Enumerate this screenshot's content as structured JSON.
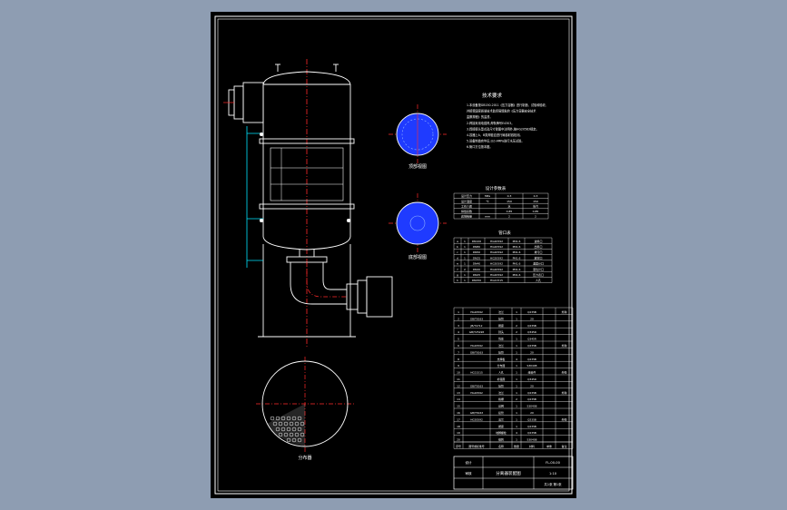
{
  "drawing": {
    "theme": {
      "background": "#8e9db2",
      "paper": "#000000",
      "line": "#ffffff",
      "centerline": "#ff2a2a",
      "nozzle": "#00e5ff",
      "view_fill": "#1f3bff"
    },
    "tech_req_title": "技术要求",
    "tech_req_lines": [
      "1.本设备按GB150-2011《压力容器》进行制造、试验和验收,",
      "并接受国家质量技术监督局颁发的《压力容器安全技术",
      "监察规程》的监督。",
      "2.焊接采用电弧焊,焊条牌号E4303。",
      "3.焊接接头型式及尺寸除图中注明外,按HG20583规定。",
      "4.容器上A、B类焊缝应进行局部射线检测。",
      "5.设备制造完毕后,以0.4MPa进行水压试验。",
      "6.管口方位按本图。"
    ],
    "view_labels": {
      "top_view": "顶部视图",
      "bottom_view": "底部视图",
      "section": "分布器"
    },
    "design_data_title": "设计参数表",
    "design_rows": [
      [
        "设计压力",
        "MPa",
        "0.3",
        "0.3"
      ],
      [
        "设计温度",
        "℃",
        "150",
        "150"
      ],
      [
        "工作介质",
        "",
        "水",
        "蒸汽"
      ],
      [
        "焊缝系数",
        "",
        "0.85",
        "0.85"
      ],
      [
        "腐蚀裕量",
        "mm",
        "2",
        "2"
      ]
    ],
    "nozzle_title": "管口表",
    "nozzle_rows": [
      [
        "a",
        "1",
        "DN100",
        "HG20592",
        "PN1.6",
        "进料口"
      ],
      [
        "b",
        "1",
        "DN80",
        "HG20592",
        "PN1.6",
        "出料口"
      ],
      [
        "c",
        "1",
        "DN50",
        "HG20592",
        "PN1.6",
        "排污口"
      ],
      [
        "d",
        "1",
        "DN25",
        "HG20592",
        "PN1.6",
        "放空口"
      ],
      [
        "e",
        "1",
        "DN40",
        "HG20592",
        "PN1.6",
        "温度计口"
      ],
      [
        "f",
        "2",
        "DN20",
        "HG20592",
        "PN1.6",
        "液位计口"
      ],
      [
        "g",
        "1",
        "DN25",
        "HG20592",
        "PN1.6",
        "压力表口"
      ],
      [
        "h",
        "1",
        "DN450",
        "HG21515",
        "",
        "人孔"
      ]
    ],
    "parts_rows": [
      [
        "1",
        "HG20592",
        "法兰",
        "1",
        "Q235B",
        "",
        "外购"
      ],
      [
        "2",
        "GB/T8163",
        "接管",
        "1",
        "20",
        "",
        ""
      ],
      [
        "3",
        "JB/T4712",
        "鞍座",
        "2",
        "Q235B",
        "",
        ""
      ],
      [
        "4",
        "GB/T25198",
        "封头",
        "2",
        "Q345R",
        "",
        ""
      ],
      [
        "5",
        "",
        "筒体",
        "1",
        "Q345R",
        "",
        ""
      ],
      [
        "6",
        "HG20592",
        "法兰",
        "1",
        "Q235B",
        "",
        "外购"
      ],
      [
        "7",
        "GB/T8163",
        "接管",
        "1",
        "20",
        "",
        ""
      ],
      [
        "8",
        "",
        "支撑板",
        "4",
        "Q235B",
        "",
        ""
      ],
      [
        "9",
        "",
        "分布器",
        "1",
        "S30408",
        "",
        ""
      ],
      [
        "10",
        "HG21515",
        "人孔",
        "1",
        "组合件",
        "",
        "外购"
      ],
      [
        "11",
        "",
        "补强圈",
        "1",
        "Q345R",
        "",
        ""
      ],
      [
        "12",
        "GB/T8163",
        "接管",
        "1",
        "20",
        "",
        ""
      ],
      [
        "13",
        "HG20592",
        "法兰",
        "1",
        "Q235B",
        "",
        "外购"
      ],
      [
        "14",
        "",
        "格栅",
        "2",
        "Q235B",
        "",
        ""
      ],
      [
        "15",
        "",
        "丝网",
        "1",
        "S30408",
        "",
        ""
      ],
      [
        "16",
        "GB/T8163",
        "接管",
        "1",
        "20",
        "",
        ""
      ],
      [
        "17",
        "HG20592",
        "法兰",
        "1",
        "Q235B",
        "",
        "外购"
      ],
      [
        "18",
        "",
        "裙座",
        "1",
        "Q235B",
        "",
        ""
      ],
      [
        "19",
        "",
        "地脚螺栓",
        "4",
        "Q235B",
        "",
        ""
      ],
      [
        "20",
        "",
        "铭牌",
        "1",
        "S30408",
        "",
        ""
      ]
    ],
    "parts_header": [
      "序号",
      "图号或标准号",
      "名称",
      "数量",
      "材料",
      "单重",
      "备注"
    ],
    "title_block": {
      "name": "分离器装配图",
      "drawing_no": "FL-00-00",
      "scale": "1:10",
      "sheet": "共1张 第1张",
      "designer": "设计",
      "checker": "审核"
    }
  }
}
